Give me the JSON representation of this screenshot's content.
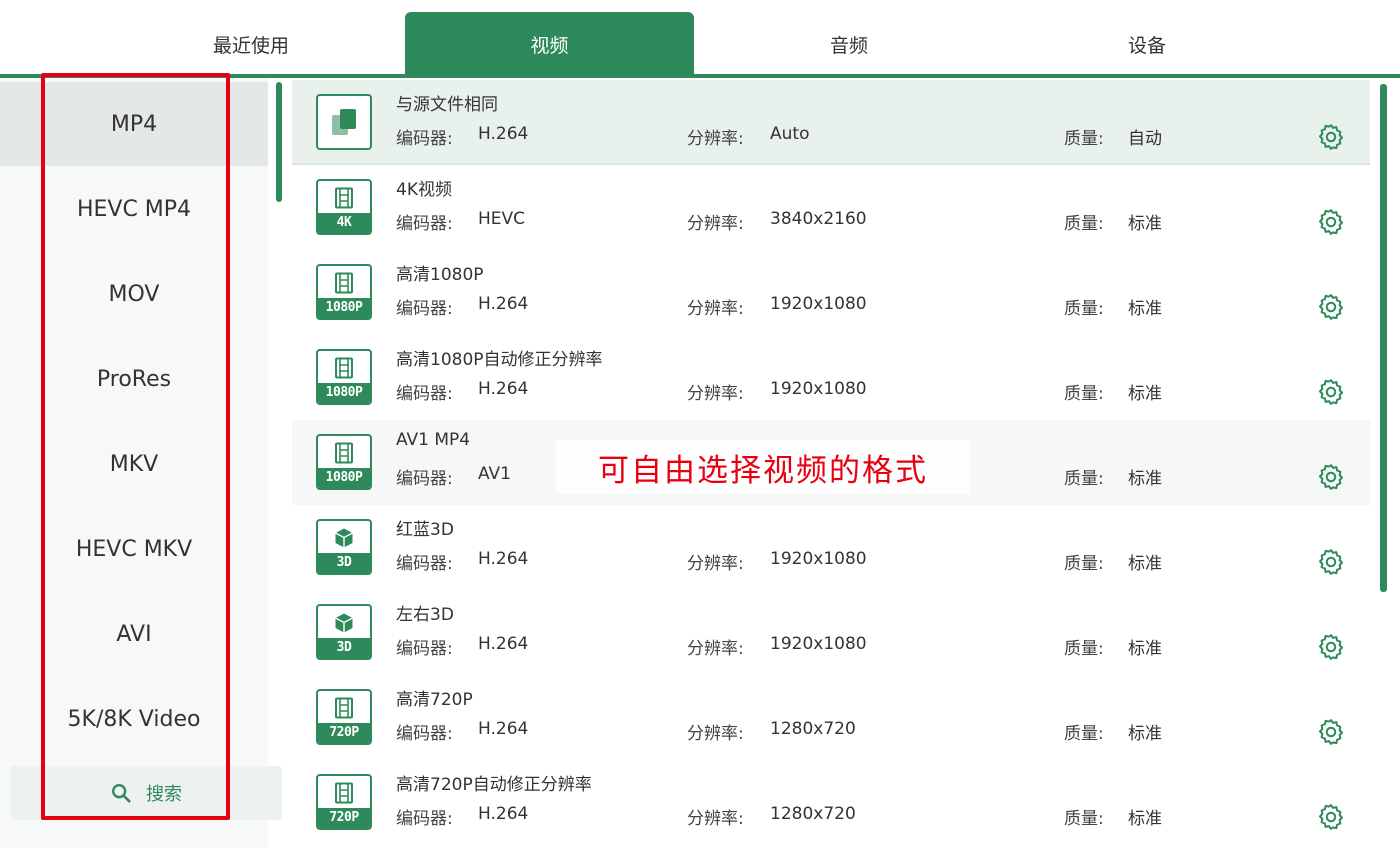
{
  "tabs": [
    "最近使用",
    "视频",
    "音频",
    "设备"
  ],
  "active_tab": "视频",
  "sidebar": {
    "items": [
      "MP4",
      "HEVC MP4",
      "MOV",
      "ProRes",
      "MKV",
      "HEVC MKV",
      "AVI",
      "5K/8K Video"
    ],
    "selected": "MP4",
    "search_label": "搜索"
  },
  "labels": {
    "codec": "编码器:",
    "resolution": "分辨率:",
    "quality": "质量:"
  },
  "presets": [
    {
      "name": "与源文件相同",
      "icon": "copy-icon",
      "badge": "",
      "codec": "H.264",
      "resolution": "Auto",
      "quality": "自动"
    },
    {
      "name": "4K视频",
      "icon": "film-icon",
      "badge": "4K",
      "codec": "HEVC",
      "resolution": "3840x2160",
      "quality": "标准"
    },
    {
      "name": "高清1080P",
      "icon": "film-icon",
      "badge": "1080P",
      "codec": "H.264",
      "resolution": "1920x1080",
      "quality": "标准"
    },
    {
      "name": "高清1080P自动修正分辨率",
      "icon": "film-icon",
      "badge": "1080P",
      "codec": "H.264",
      "resolution": "1920x1080",
      "quality": "标准"
    },
    {
      "name": "AV1 MP4",
      "icon": "film-icon",
      "badge": "1080P",
      "codec": "AV1",
      "resolution": "",
      "quality": "标准"
    },
    {
      "name": "红蓝3D",
      "icon": "cube-icon",
      "badge": "3D",
      "codec": "H.264",
      "resolution": "1920x1080",
      "quality": "标准"
    },
    {
      "name": "左右3D",
      "icon": "cube-icon",
      "badge": "3D",
      "codec": "H.264",
      "resolution": "1920x1080",
      "quality": "标准"
    },
    {
      "name": "高清720P",
      "icon": "film-icon",
      "badge": "720P",
      "codec": "H.264",
      "resolution": "1280x720",
      "quality": "标准"
    },
    {
      "name": "高清720P自动修正分辨率",
      "icon": "film-icon",
      "badge": "720P",
      "codec": "H.264",
      "resolution": "1280x720",
      "quality": "标准"
    }
  ],
  "annotation": "可自由选择视频的格式",
  "colors": {
    "accent": "#2e8a5b",
    "highlight": "#e60012"
  }
}
